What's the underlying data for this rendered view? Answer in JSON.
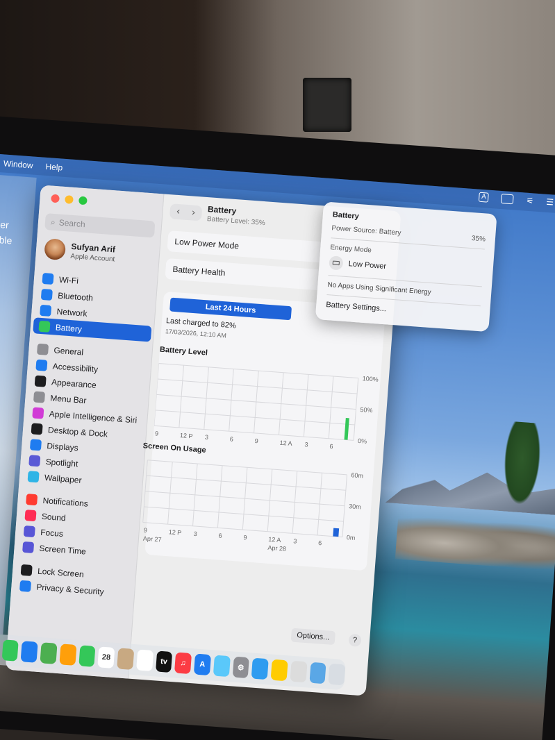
{
  "menubar": {
    "items": [
      "Window",
      "Help"
    ],
    "status_input_icon": "A"
  },
  "widget": {
    "line1": "her",
    "line2": "able"
  },
  "window": {
    "search_placeholder": "Search",
    "profile": {
      "name": "Sufyan Arif",
      "subtitle": "Apple Account"
    },
    "sidebar": {
      "groups": [
        [
          {
            "label": "Wi-Fi",
            "icon": "wifi-icon",
            "color": "#1f7cf0"
          },
          {
            "label": "Bluetooth",
            "icon": "bluetooth-icon",
            "color": "#1f7cf0"
          },
          {
            "label": "Network",
            "icon": "globe-icon",
            "color": "#1f7cf0"
          },
          {
            "label": "Battery",
            "icon": "battery-icon",
            "color": "#34c759",
            "active": true
          }
        ],
        [
          {
            "label": "General",
            "icon": "gear-icon",
            "color": "#8e8e93"
          },
          {
            "label": "Accessibility",
            "icon": "accessibility-icon",
            "color": "#1f7cf0"
          },
          {
            "label": "Appearance",
            "icon": "appearance-icon",
            "color": "#1d1d1f"
          },
          {
            "label": "Menu Bar",
            "icon": "menu-bar-icon",
            "color": "#8e8e93"
          },
          {
            "label": "Apple Intelligence & Siri",
            "icon": "siri-icon",
            "color": "#d13bd6"
          },
          {
            "label": "Desktop & Dock",
            "icon": "dock-icon",
            "color": "#1d1d1f"
          },
          {
            "label": "Displays",
            "icon": "displays-icon",
            "color": "#1f7cf0"
          },
          {
            "label": "Spotlight",
            "icon": "spotlight-icon",
            "color": "#5a5ad6"
          },
          {
            "label": "Wallpaper",
            "icon": "wallpaper-icon",
            "color": "#2fb4e6"
          }
        ],
        [
          {
            "label": "Notifications",
            "icon": "notifications-icon",
            "color": "#ff3b30"
          },
          {
            "label": "Sound",
            "icon": "sound-icon",
            "color": "#ff2d55"
          },
          {
            "label": "Focus",
            "icon": "focus-icon",
            "color": "#5856d6"
          },
          {
            "label": "Screen Time",
            "icon": "screen-time-icon",
            "color": "#5856d6"
          }
        ],
        [
          {
            "label": "Lock Screen",
            "icon": "lock-screen-icon",
            "color": "#1d1d1f"
          },
          {
            "label": "Privacy & Security",
            "icon": "privacy-icon",
            "color": "#1f7cf0"
          }
        ]
      ]
    },
    "content": {
      "title": "Battery",
      "subtitle": "Battery Level: 35%",
      "rows": [
        "Low Power Mode",
        "Battery Health"
      ],
      "range_button": "Last 24 Hours",
      "last_charged": "Last charged to 82%",
      "last_charged_time": "17/03/2026, 12:10 AM",
      "options_label": "Options...",
      "help_label": "?"
    }
  },
  "chart_data": [
    {
      "type": "bar",
      "title": "Battery Level",
      "x_tick_labels": [
        "9",
        "12 P",
        "3",
        "6",
        "9",
        "12 A",
        "3",
        "6"
      ],
      "y_tick_labels": [
        "100%",
        "50%",
        "0%"
      ],
      "ylim": [
        0,
        100
      ],
      "series": [
        {
          "values": [
            0,
            0,
            0,
            0,
            0,
            0,
            0,
            35
          ]
        }
      ],
      "grid": true
    },
    {
      "type": "bar",
      "title": "Screen On Usage",
      "x_tick_labels": [
        "9",
        "12 P",
        "3",
        "6",
        "9",
        "12 A",
        "3",
        "6"
      ],
      "date_labels": [
        "Apr 27",
        "Apr 28"
      ],
      "y_tick_labels": [
        "60m",
        "30m",
        "0m"
      ],
      "ylim": [
        0,
        60
      ],
      "series": [
        {
          "values": [
            0,
            0,
            0,
            0,
            0,
            0,
            0,
            8
          ]
        }
      ],
      "grid": true
    }
  ],
  "popover": {
    "title": "Battery",
    "power_source_label": "Power Source: Battery",
    "percent": "35%",
    "energy_mode_label": "Energy Mode",
    "low_power_label": "Low Power",
    "no_apps_label": "No Apps Using Significant Energy",
    "settings_label": "Battery Settings..."
  },
  "dock": {
    "items": [
      {
        "icon": "safari-icon",
        "color": "#1f7cf0",
        "text": ""
      },
      {
        "icon": "notes-icon",
        "color": "#f5d547",
        "text": ""
      },
      {
        "icon": "messages-icon",
        "color": "#34c759",
        "text": ""
      },
      {
        "icon": "mail-icon",
        "color": "#1f7cf0",
        "text": ""
      },
      {
        "icon": "maps-icon",
        "color": "#4caf50",
        "text": ""
      },
      {
        "icon": "photos-icon",
        "color": "#ff9f0a",
        "text": ""
      },
      {
        "icon": "facetime-icon",
        "color": "#34c759",
        "text": ""
      },
      {
        "icon": "calendar-icon",
        "color": "#ffffff",
        "text": "28"
      },
      {
        "icon": "contacts-icon",
        "color": "#c8a982",
        "text": ""
      },
      {
        "icon": "reminders-icon",
        "color": "#ffffff",
        "text": ""
      },
      {
        "icon": "tv-icon",
        "color": "#111111",
        "text": "tv"
      },
      {
        "icon": "music-icon",
        "color": "#fc3c44",
        "text": "♫"
      },
      {
        "icon": "app-store-icon",
        "color": "#1f7cf0",
        "text": "A"
      },
      {
        "icon": "preview-icon",
        "color": "#5ac8fa",
        "text": ""
      },
      {
        "icon": "system-settings-icon",
        "color": "#8e8e93",
        "text": "⚙"
      },
      {
        "icon": "finder-icon",
        "color": "#2f9cf0",
        "text": ""
      },
      {
        "icon": "tips-icon",
        "color": "#ffcc00",
        "text": ""
      },
      {
        "icon": "archive-icon",
        "color": "#dcdcdc",
        "text": ""
      },
      {
        "icon": "downloads-icon",
        "color": "#5aa7e6",
        "text": ""
      },
      {
        "icon": "trash-icon",
        "color": "#d8dde3",
        "text": ""
      }
    ]
  }
}
